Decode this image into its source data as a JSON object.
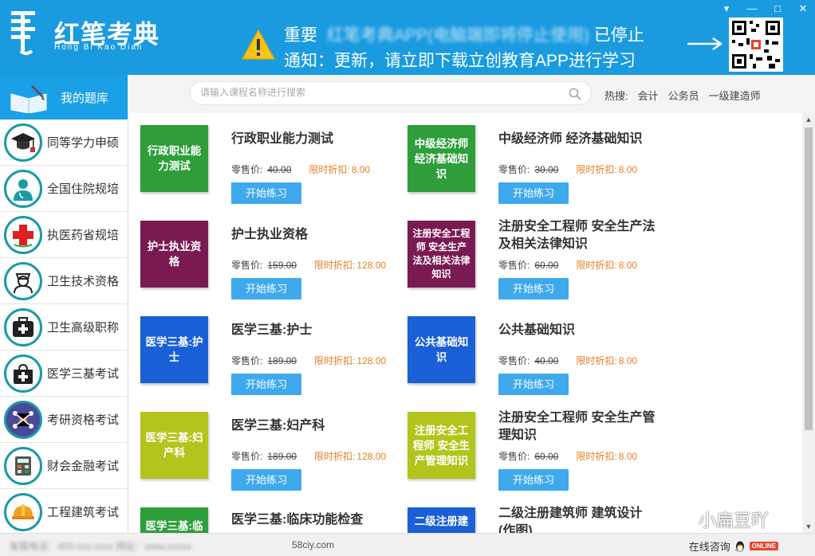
{
  "header": {
    "logo_text": "红笔考典",
    "logo_sub": "Hong Bi Kao Dian",
    "notice_line1_prefix": "重要",
    "notice_line1_blurred": "红笔考典APP(电脑端即将停止使用)",
    "notice_line1_suffix": "已停止",
    "notice_line2": "通知：更新，请立即下载立创教育APP进行学习"
  },
  "window_controls": {
    "menu": "▾",
    "minimize": "—",
    "maximize": "□",
    "close": "✕"
  },
  "sidebar": {
    "top_label": "我的题库",
    "items": [
      {
        "label": "同等学力申硕",
        "icon": "graduation-cap-icon"
      },
      {
        "label": "全国住院规培",
        "icon": "doctor-icon"
      },
      {
        "label": "执医药省规培",
        "icon": "red-cross-icon"
      },
      {
        "label": "卫生技术资格",
        "icon": "nurse-icon"
      },
      {
        "label": "卫生高级职称",
        "icon": "medical-kit-icon"
      },
      {
        "label": "医学三基考试",
        "icon": "first-aid-bag-icon"
      },
      {
        "label": "考研资格考试",
        "icon": "network-icon"
      },
      {
        "label": "财会金融考试",
        "icon": "calculator-icon"
      },
      {
        "label": "工程建筑考试",
        "icon": "hard-hat-icon"
      }
    ]
  },
  "search": {
    "placeholder": "请输入课程名称进行搜索"
  },
  "hot": {
    "label": "热搜:",
    "keywords": [
      "会计",
      "公务员",
      "一级建造师"
    ]
  },
  "labels": {
    "price": "零售价:",
    "discount": "限时折扣:",
    "start": "开始练习"
  },
  "courses": [
    {
      "cover": "行政职业能力测试",
      "title": "行政职业能力测试",
      "price": "40.00",
      "discount": "8.00",
      "color": "#2e9e3a"
    },
    {
      "cover": "中级经济师经济基础知识",
      "title": "中级经济师 经济基础知识",
      "price": "30.00",
      "discount": "8.00",
      "color": "#2e9e3a"
    },
    {
      "cover": "护士执业资格",
      "title": "护士执业资格",
      "price": "159.00",
      "discount": "128.00",
      "color": "#7a1a52"
    },
    {
      "cover": "注册安全工程师 安全生产法及相关法律知识",
      "title": "注册安全工程师 安全生产法及相关法律知识",
      "price": "60.00",
      "discount": "8.00",
      "color": "#7a1a52"
    },
    {
      "cover": "医学三基:护士",
      "title": "医学三基:护士",
      "price": "189.00",
      "discount": "128.00",
      "color": "#1a5fd6"
    },
    {
      "cover": "公共基础知识",
      "title": "公共基础知识",
      "price": "40.00",
      "discount": "8.00",
      "color": "#1a5fd6"
    },
    {
      "cover": "医学三基:妇产科",
      "title": "医学三基:妇产科",
      "price": "189.00",
      "discount": "128.00",
      "color": "#b3c51c"
    },
    {
      "cover": "注册安全工程师 安全生产管理知识",
      "title": "注册安全工程师 安全生产管理知识",
      "price": "60.00",
      "discount": "8.00",
      "color": "#b3c51c"
    },
    {
      "cover": "医学三基:临",
      "title": "医学三基:临床功能检查",
      "price": "",
      "discount": "",
      "color": "#2e9e3a"
    },
    {
      "cover": "二级注册建",
      "title": "二级注册建筑师 建筑设计(作图)",
      "price": "",
      "discount": "",
      "color": "#1a5fd6"
    }
  ],
  "footer": {
    "blurred": "客服电话：400-xxx-xxxx 网址：www.xxxxx",
    "url": "58ciy.com",
    "consult": "在线咨询",
    "online": "ONLINE"
  },
  "watermark": "小扁豆吖"
}
